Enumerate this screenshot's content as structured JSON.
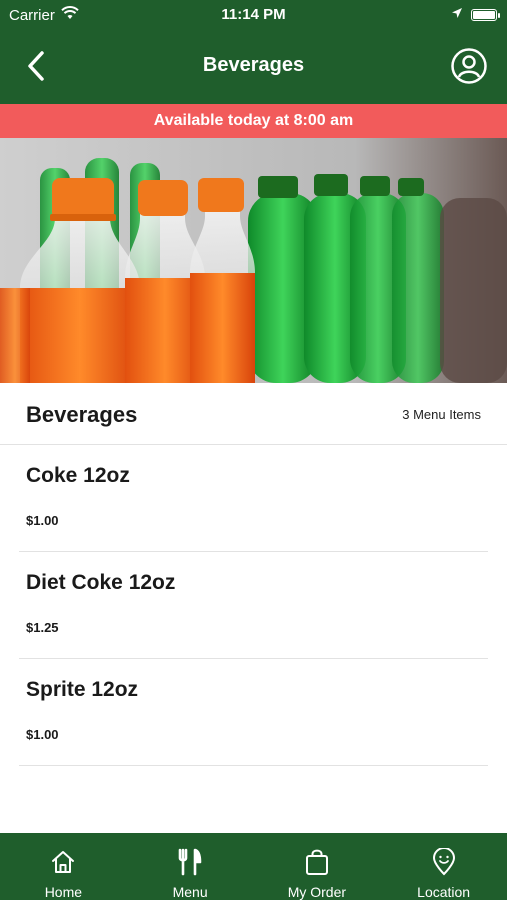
{
  "status_bar": {
    "carrier": "Carrier",
    "time": "11:14 PM"
  },
  "header": {
    "title": "Beverages"
  },
  "banner": {
    "text": "Available today at 8:00 am"
  },
  "hero": {
    "image": "soda-bottles-photo"
  },
  "section": {
    "title": "Beverages",
    "count_label": "3 Menu Items"
  },
  "items": [
    {
      "name": "Coke 12oz",
      "price": "$1.00"
    },
    {
      "name": "Diet Coke 12oz",
      "price": "$1.25"
    },
    {
      "name": "Sprite 12oz",
      "price": "$1.00"
    }
  ],
  "tabbar": {
    "tabs": [
      {
        "label": "Home",
        "icon": "home-icon"
      },
      {
        "label": "Menu",
        "icon": "fork-knife-icon"
      },
      {
        "label": "My Order",
        "icon": "shopping-bag-icon"
      },
      {
        "label": "Location",
        "icon": "location-pin-icon"
      }
    ]
  },
  "colors": {
    "primary": "#1f5e2c",
    "banner": "#f25b5b",
    "text": "#1a1a1a"
  }
}
